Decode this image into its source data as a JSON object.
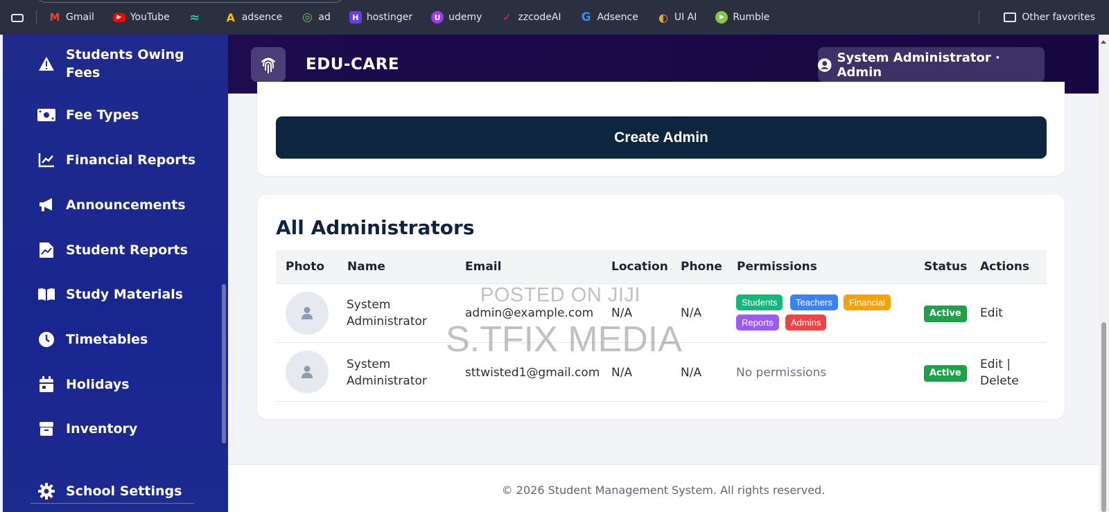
{
  "bookmarks": {
    "items": [
      {
        "label": "Gmail",
        "icon": "gmail-icon",
        "color": "#d93025",
        "glyph": "M"
      },
      {
        "label": "YouTube",
        "icon": "youtube-icon",
        "color": "#ff0000",
        "glyph": "▶"
      },
      {
        "label": "",
        "icon": "bolt-icon",
        "color": "#2bc48a",
        "glyph": "≈"
      },
      {
        "label": "adsence",
        "icon": "google-ads-icon",
        "color": "#fbbc04",
        "glyph": "A"
      },
      {
        "label": "ad",
        "icon": "ad-icon",
        "color": "#3aa04a",
        "glyph": "◎"
      },
      {
        "label": "hostinger",
        "icon": "hostinger-icon",
        "color": "#673de6",
        "glyph": "H"
      },
      {
        "label": "udemy",
        "icon": "udemy-icon",
        "color": "#a435f0",
        "glyph": "U"
      },
      {
        "label": "zzcodeAI",
        "icon": "zzcode-icon",
        "color": "#e0302b",
        "glyph": "✓"
      },
      {
        "label": "Adsence",
        "icon": "google-icon",
        "color": "#4285f4",
        "glyph": "G"
      },
      {
        "label": "UI AI",
        "icon": "ui-ai-icon",
        "color": "#e4a13a",
        "glyph": "◐"
      },
      {
        "label": "Rumble",
        "icon": "rumble-icon",
        "color": "#85c742",
        "glyph": "▶"
      }
    ],
    "other_label": "Other favorites"
  },
  "sidebar": {
    "items": [
      {
        "label_line1": "Students Owing",
        "label_line2": "Fees",
        "icon": "warning-icon"
      },
      {
        "label": "Fee Types",
        "icon": "money-icon"
      },
      {
        "label": "Financial Reports",
        "icon": "chart-line-icon"
      },
      {
        "label": "Announcements",
        "icon": "megaphone-icon"
      },
      {
        "label": "Student Reports",
        "icon": "report-icon"
      },
      {
        "label": "Study Materials",
        "icon": "book-icon"
      },
      {
        "label": "Timetables",
        "icon": "clock-icon"
      },
      {
        "label": "Holidays",
        "icon": "calendar-icon"
      },
      {
        "label": "Inventory",
        "icon": "box-icon"
      },
      {
        "label": "School Settings",
        "icon": "gear-icon"
      }
    ]
  },
  "header": {
    "brand": "EDU-CARE",
    "user_label": "System Administrator · Admin"
  },
  "create": {
    "button_label": "Create Admin"
  },
  "table": {
    "title": "All Administrators",
    "columns": [
      "Photo",
      "Name",
      "Email",
      "Location",
      "Phone",
      "Permissions",
      "Status",
      "Actions"
    ],
    "rows": [
      {
        "name_line1": "System",
        "name_line2": "Administrator",
        "email": "admin@example.com",
        "location": "N/A",
        "phone": "N/A",
        "permissions": [
          "Students",
          "Teachers",
          "Financial",
          "Reports",
          "Admins"
        ],
        "status": "Active",
        "action1": "Edit"
      },
      {
        "name_line1": "System",
        "name_line2": "Administrator",
        "email": "sttwisted1@gmail.com",
        "location": "N/A",
        "phone": "N/A",
        "no_permissions": "No permissions",
        "status": "Active",
        "action1": "Edit |",
        "action2": "Delete"
      }
    ]
  },
  "watermark": {
    "line1": "POSTED ON JIJI",
    "line2": "S.TFIX MEDIA"
  },
  "colors": {
    "students": "#14b87a",
    "teachers": "#3b82f6",
    "financial": "#f5a30b",
    "reports": "#9b5cf6",
    "admins": "#ef4444",
    "active": "#1fa14a"
  },
  "footer": {
    "text": "© 2026 Student Management System. All rights reserved."
  }
}
